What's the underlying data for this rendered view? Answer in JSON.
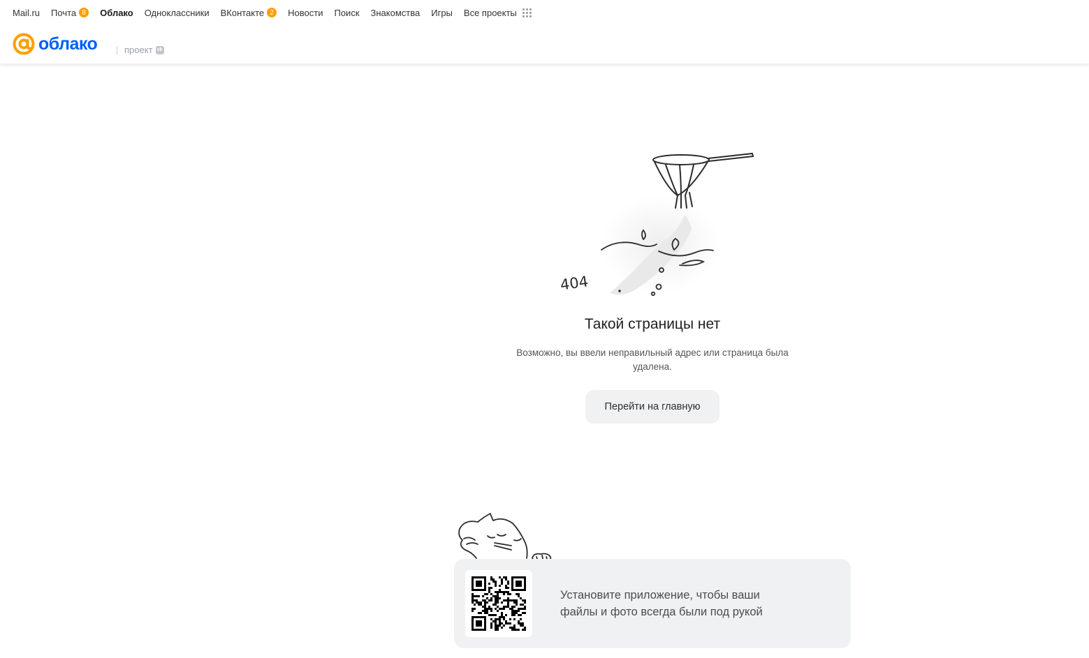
{
  "portal": {
    "links": [
      {
        "label": "Mail.ru"
      },
      {
        "label": "Почта",
        "badge": "8"
      },
      {
        "label": "Облако",
        "active": true
      },
      {
        "label": "Одноклассники"
      },
      {
        "label": "ВКонтакте",
        "badge": "2"
      },
      {
        "label": "Новости"
      },
      {
        "label": "Поиск"
      },
      {
        "label": "Знакомства"
      },
      {
        "label": "Игры"
      },
      {
        "label": "Все проекты",
        "icon": "apps-grid-icon"
      }
    ],
    "badge_color": "#ff9e00"
  },
  "header": {
    "logo_word": "облако",
    "project_label": "проект",
    "vk_badge": "vk",
    "brand_color": "#005ff9",
    "accent_color": "#ff9e00"
  },
  "error": {
    "code": "404",
    "title": "Такой страницы нет",
    "description": "Возможно, вы ввели неправильный адрес или страница была удалена.",
    "home_button": "Перейти на главную"
  },
  "app_banner": {
    "text": "Установите приложение, чтобы ваши файлы и фото всегда были под рукой",
    "qr_icon": "qr-code-icon"
  }
}
